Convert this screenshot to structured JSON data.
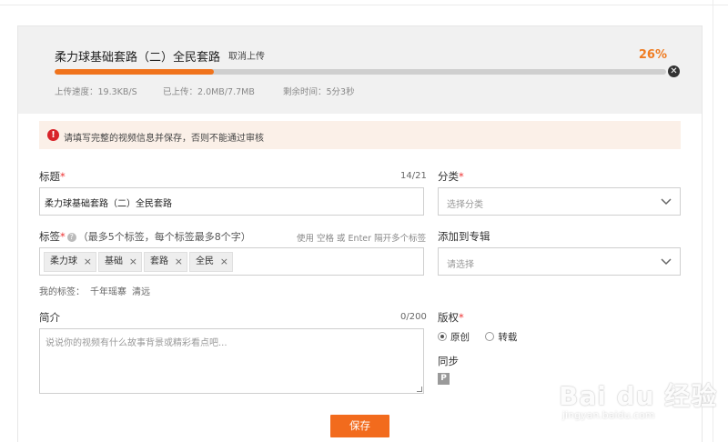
{
  "upload": {
    "title": "柔力球基础套路（二）全民套路",
    "cancel_label": "取消上传",
    "percent_label": "26%",
    "progress": 0.26,
    "speed": "上传速度：19.3KB/S",
    "uploaded": "已上传：2.0MB/7.7MB",
    "remaining": "剩余时间：5分3秒"
  },
  "warning": {
    "text": "请填写完整的视频信息并保存，否则不能通过审核"
  },
  "title_field": {
    "label": "标题",
    "required_mark": "*",
    "counter": "14/21",
    "value": "柔力球基础套路（二）全民套路"
  },
  "category": {
    "label": "分类",
    "required_mark": "*",
    "placeholder": "选择分类"
  },
  "tags_field": {
    "label": "标签",
    "required_mark": "*",
    "hint": "（最多5个标签，每个标签最多8个字）",
    "tip": "使用 空格 或 Enter 隔开多个标签",
    "tags": [
      {
        "label": "柔力球"
      },
      {
        "label": "基础"
      },
      {
        "label": "套路"
      },
      {
        "label": "全民"
      }
    ],
    "remove_symbol": "×"
  },
  "album": {
    "label": "添加到专辑",
    "placeholder": "请选择"
  },
  "my_tags": {
    "label": "我的标签：",
    "items": [
      "千年瑶寨",
      "清远"
    ]
  },
  "intro": {
    "label": "简介",
    "counter": "0/200",
    "placeholder": "说说你的视频有什么故事背景或精彩看点吧..."
  },
  "copyright": {
    "label": "版权",
    "required_mark": "*",
    "options": [
      {
        "label": "原创",
        "selected": true
      },
      {
        "label": "转载",
        "selected": false
      }
    ]
  },
  "sync": {
    "label": "同步",
    "icon": "P"
  },
  "save_label": "保存",
  "watermark": {
    "text": "Bai du 经验",
    "sub": "jingyan.baidu.com"
  },
  "colors": {
    "accent": "#f26b1d",
    "progress": "#f0731c",
    "warning_bg": "#fbf0e8",
    "warning_icon": "#d8232a"
  }
}
